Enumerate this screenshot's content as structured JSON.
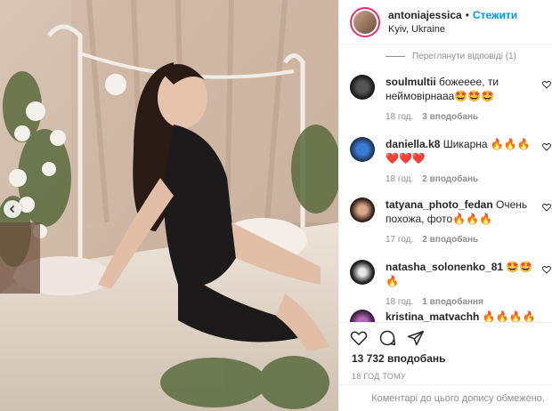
{
  "post": {
    "username": "antoniajessica",
    "separator": "•",
    "follow_label": "Стежити",
    "location": "Kyiv, Ukraine"
  },
  "view_replies": "Переглянути відповіді (1)",
  "comments": [
    {
      "user": "soulmultii",
      "text": "божееее, ти неймовірнааа🤩🤩🤩",
      "time": "18 год.",
      "likes": "3 вподобань"
    },
    {
      "user": "daniella.k8",
      "text": "Шикарна 🔥🔥🔥❤️❤️❤️",
      "time": "18 год.",
      "likes": "2 вподобань"
    },
    {
      "user": "tatyana_photo_fedan",
      "text": "Очень похожа, фото🔥🔥🔥",
      "time": "17 год.",
      "likes": "2 вподобань"
    },
    {
      "user": "natasha_solonenko_81",
      "text": "🤩🤩🔥",
      "time": "18 год.",
      "likes": "1 вподобання"
    },
    {
      "user": "kristina_matvachh",
      "text": "🔥🔥🔥🔥🔥🔥",
      "time": "",
      "likes": ""
    }
  ],
  "likes_count": "13 732 вподобань",
  "time_ago": "18 ГОД ТОМУ",
  "restricted_text": "Коментарі до цього допису обмежено.",
  "colors": {
    "accent": "#0095f6",
    "muted": "#8e8e8e",
    "text": "#262626"
  },
  "icons": [
    "heart-icon",
    "comment-icon",
    "share-icon",
    "chevron-left-icon"
  ]
}
